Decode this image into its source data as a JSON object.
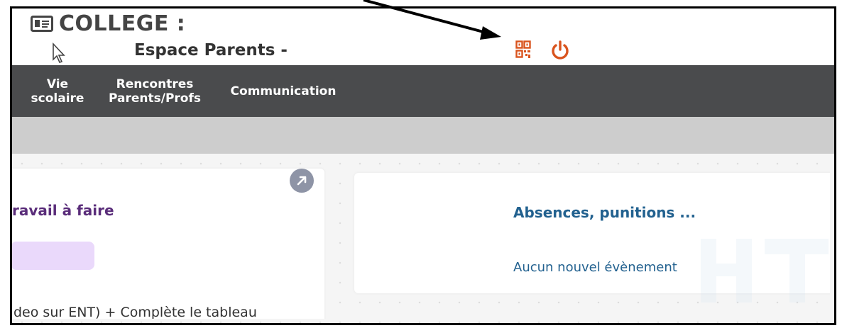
{
  "header": {
    "school_name": "COLLEGE :",
    "subtitle": "Espace Parents -"
  },
  "icons": {
    "school": "id-card-icon",
    "qr": "qr-code-icon",
    "power": "power-icon",
    "cursor": "mouse-cursor-icon",
    "expand": "expand-arrow-icon"
  },
  "nav": {
    "items": [
      {
        "label": "Vie\nscolaire"
      },
      {
        "label": "Rencontres\nParents/Profs"
      },
      {
        "label": "Communication"
      }
    ]
  },
  "cards": {
    "left": {
      "title": "ravail à faire",
      "text": "deo sur ENT) + Complète le tableau"
    },
    "right": {
      "title": "Absences, punitions ...",
      "text": "Aucun nouvel évènement"
    }
  },
  "colors": {
    "nav_bg": "#4a4b4d",
    "accent_orange": "#d9541e",
    "left_title": "#5a2d7a",
    "right_title": "#22618f",
    "pill": "#ead9fb"
  }
}
